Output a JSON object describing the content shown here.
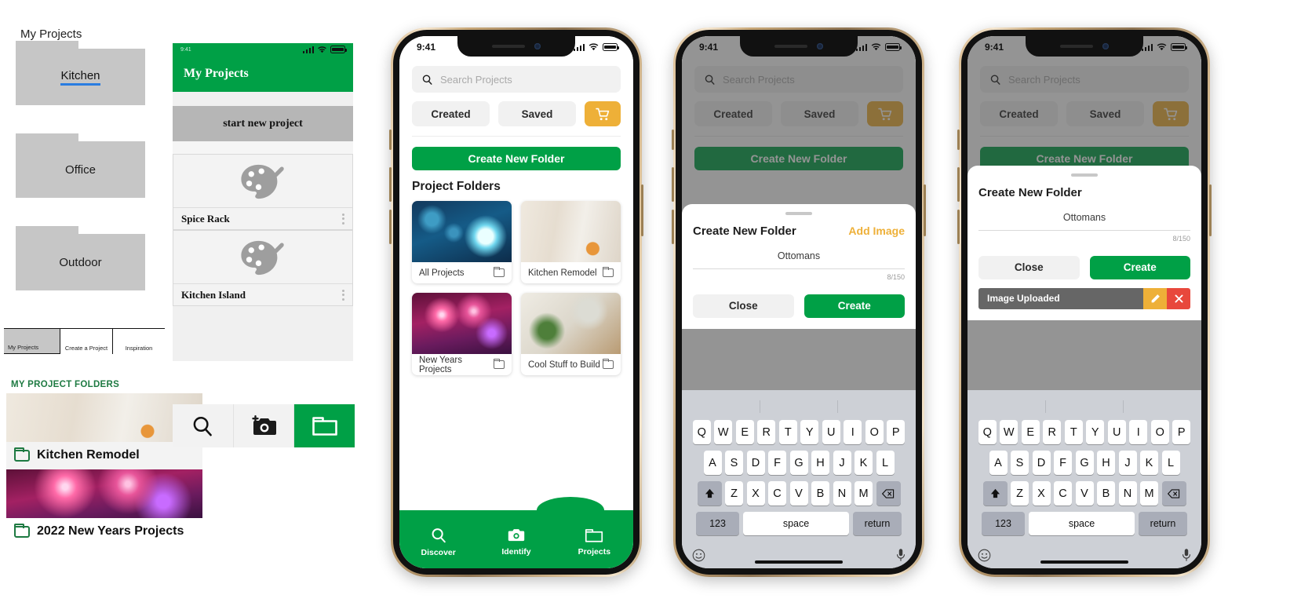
{
  "wireframe_a": {
    "title": "My Projects",
    "folders": [
      {
        "label": "Kitchen",
        "linked": true
      },
      {
        "label": "Office",
        "linked": false
      },
      {
        "label": "Outdoor",
        "linked": false
      }
    ],
    "tabs": [
      {
        "label": "My Projects",
        "active": true
      },
      {
        "label": "Create a Project",
        "active": false
      },
      {
        "label": "Inspiration",
        "active": false
      }
    ]
  },
  "wireframe_b": {
    "status_time": "9:41",
    "header_title": "My Projects",
    "new_project_label": "start new project",
    "cards": [
      {
        "label": "Spice Rack",
        "icon": "palette-icon"
      },
      {
        "label": "Kitchen Island",
        "icon": "palette-icon"
      }
    ],
    "icon_bar": [
      {
        "name": "search-icon",
        "active": false
      },
      {
        "name": "camera-add-icon",
        "active": false
      },
      {
        "name": "folder-icon",
        "active": true
      }
    ]
  },
  "wireframe_d": {
    "heading": "MY PROJECT FOLDERS",
    "items": [
      {
        "label": "Kitchen Remodel",
        "thumb": "img-kitchen"
      },
      {
        "label": "2022 New Years Projects",
        "thumb": "img-fireworks"
      }
    ]
  },
  "phone1": {
    "status": {
      "time": "9:41"
    },
    "search": {
      "placeholder": "Search Projects",
      "icon": "search-icon"
    },
    "filters": [
      {
        "label": "Created"
      },
      {
        "label": "Saved"
      }
    ],
    "cart_icon": "shopping-cart-icon",
    "cta_label": "Create New Folder",
    "section_title": "Project Folders",
    "folders": [
      {
        "label": "All Projects",
        "thumb": "img-bulbs"
      },
      {
        "label": "Kitchen Remodel",
        "thumb": "img-kitchen"
      },
      {
        "label": "New Years Projects",
        "thumb": "img-fireworks"
      },
      {
        "label": "Cool Stuff to Build",
        "thumb": "img-tools"
      }
    ],
    "tabs": [
      {
        "label": "Discover",
        "icon": "search-icon",
        "active": false
      },
      {
        "label": "Identify",
        "icon": "camera-icon",
        "active": false
      },
      {
        "label": "Projects",
        "icon": "folder-icon",
        "active": true
      }
    ]
  },
  "phone2": {
    "status": {
      "time": "9:41"
    },
    "search": {
      "placeholder": "Search Projects"
    },
    "filters": [
      {
        "label": "Created"
      },
      {
        "label": "Saved"
      }
    ],
    "cta_label": "Create New Folder",
    "sheet": {
      "title": "Create New Folder",
      "action_label": "Add Image",
      "input_value": "Ottomans",
      "counter": "8/150",
      "close_label": "Close",
      "create_label": "Create"
    },
    "keyboard": {
      "row1": [
        "Q",
        "W",
        "E",
        "R",
        "T",
        "Y",
        "U",
        "I",
        "O",
        "P"
      ],
      "row2": [
        "A",
        "S",
        "D",
        "F",
        "G",
        "H",
        "J",
        "K",
        "L"
      ],
      "row3": [
        "Z",
        "X",
        "C",
        "V",
        "B",
        "N",
        "M"
      ],
      "shift_icon": "shift-up-icon",
      "backspace_icon": "backspace-icon",
      "numbers_label": "123",
      "space_label": "space",
      "return_label": "return",
      "emoji_icon": "emoji-smiley-icon",
      "mic_icon": "microphone-icon"
    }
  },
  "phone3": {
    "status": {
      "time": "9:41"
    },
    "search": {
      "placeholder": "Search Projects"
    },
    "filters": [
      {
        "label": "Created"
      },
      {
        "label": "Saved"
      }
    ],
    "cta_label": "Create New Folder",
    "sheet": {
      "title": "Create New Folder",
      "input_value": "Ottomans",
      "counter": "8/150",
      "close_label": "Close",
      "create_label": "Create",
      "uploaded_label": "Image Uploaded",
      "edit_icon": "pencil-edit-icon",
      "delete_icon": "close-x-icon"
    },
    "keyboard": {
      "row1": [
        "Q",
        "W",
        "E",
        "R",
        "T",
        "Y",
        "U",
        "I",
        "O",
        "P"
      ],
      "row2": [
        "A",
        "S",
        "D",
        "F",
        "G",
        "H",
        "J",
        "K",
        "L"
      ],
      "row3": [
        "Z",
        "X",
        "C",
        "V",
        "B",
        "N",
        "M"
      ],
      "numbers_label": "123",
      "space_label": "space",
      "return_label": "return"
    }
  },
  "colors": {
    "green": "#00a046",
    "amber": "#eeb038",
    "red": "#e8483c",
    "grey": "#666666"
  }
}
